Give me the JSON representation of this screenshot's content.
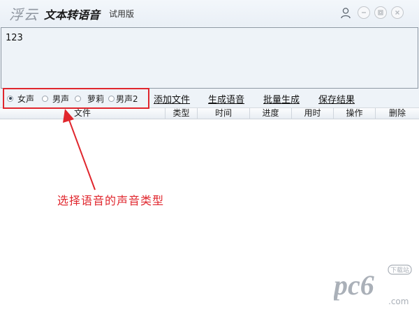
{
  "window": {
    "logo_text": "浮云",
    "app_name": "文本转语音",
    "edition": "试用版"
  },
  "icons": {
    "user": "user-icon",
    "minimize": "minimize-icon",
    "maximize": "maximize-icon",
    "close": "close-icon",
    "arrow": "annotation-arrow-icon"
  },
  "editor": {
    "value": "123"
  },
  "voices": {
    "options": [
      {
        "label": "女声",
        "selected": true
      },
      {
        "label": "男声",
        "selected": false
      },
      {
        "label": "萝莉",
        "selected": false
      },
      {
        "label": "男声2",
        "selected": false
      }
    ]
  },
  "actions": {
    "add_file": "添加文件",
    "generate": "生成语音",
    "batch": "批量生成",
    "save": "保存结果"
  },
  "table": {
    "columns": [
      "文件",
      "类型",
      "时间",
      "进度",
      "用时",
      "操作",
      "删除"
    ],
    "rows": []
  },
  "annotation": {
    "text": "选择语音的声音类型"
  },
  "watermark": {
    "brand": "pc6",
    "badge": "下载站",
    "domain": ".com"
  },
  "colors": {
    "annotation": "#e0262d",
    "background": "#eef3f8",
    "watermark": "#9aa0a8"
  }
}
